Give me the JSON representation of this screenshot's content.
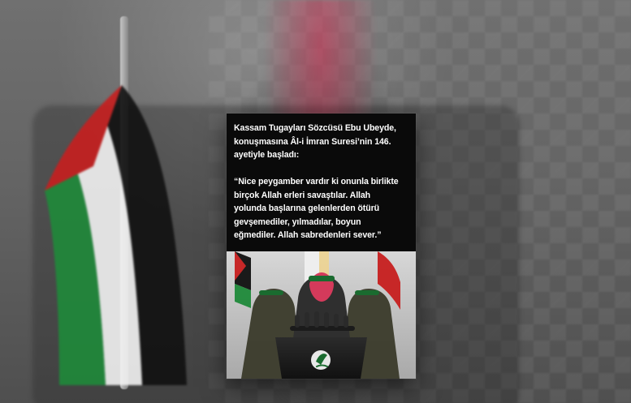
{
  "overlay": {
    "caption": "Kassam Tugayları Sözcüsü Ebu Ubeyde,\nkonuşmasına Âl-i İmran Suresi’nin 146.\nayetiyle başladı:\n\n“Nice peygamber vardır ki onunla birlikte\nbirçok Allah erleri savaştılar. Allah\nyolunda başlarına gelenlerden ötürü\ngevşemediler, yılmadılar, boyun\neğmediler. Allah sabredenleri sever.”"
  },
  "colors": {
    "overlay_background": "#0a0a0a",
    "caption_text": "#ffffff",
    "flag_black": "#111111",
    "flag_white": "#f2f2f2",
    "flag_green": "#1f8a3a",
    "flag_red": "#c71f1f",
    "headband_green": "#1a6b2f",
    "mask_red": "#d43a5b"
  },
  "icons": {
    "speaker_emblem": "green-emblem-icon"
  }
}
